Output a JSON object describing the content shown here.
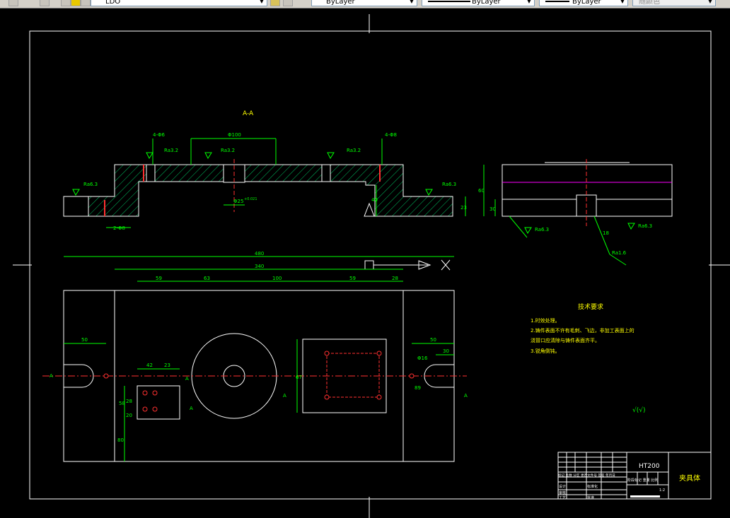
{
  "toolbar": {
    "layer_name": "LDO",
    "color_value": "ByLayer",
    "linetype_value": "ByLayer",
    "lineweight_value": "ByLayer",
    "plotstyle_value": "随颜色"
  },
  "drawing": {
    "section_title": "A-A",
    "section_labels": {
      "hole_4_left": "4-Φ6",
      "hole_4_right": "4-Φ8",
      "slot_2": "2-Φ8",
      "bore_100": "Φ100",
      "bore_25": "Φ25",
      "tol_h8": "H8",
      "tol_top": "+0.021",
      "tol_bot": "0",
      "dim_40": "40",
      "dim_23": "23",
      "dim_60": "60",
      "dim_30": "30",
      "dim_18": "18",
      "ra32_a": "Ra3.2",
      "ra32_b": "Ra3.2",
      "ra32_c": "Ra3.2",
      "ra32_d": "Ra3.2",
      "ra63_a": "Ra6.3",
      "ra63_b": "Ra6.3",
      "ra63_c": "Ra6.3",
      "ra63_d": "Ra6.3",
      "ra63_e": "Ra6.3",
      "ra16": "Ra1.6"
    },
    "plan_dims": {
      "overall_480": "480",
      "overall_340": "340",
      "d59_left": "59",
      "d63": "63",
      "d100": "100",
      "d59_right": "59",
      "d28": "28",
      "d50_left": "50",
      "d50_right": "50",
      "d30": "30",
      "d42": "42",
      "d23": "23",
      "d16": "Φ16",
      "d89": "89",
      "d67": "67",
      "d58": "58",
      "d28v": "28",
      "d20": "20",
      "d80": "80"
    },
    "section_marks": {
      "a_left": "A",
      "a_right": "A",
      "a_small1": "A",
      "a_small2": "A",
      "a_small3": "A"
    },
    "tech_req": {
      "title": "技术要求",
      "line1": "1.时效处理。",
      "line2": "2.铸件表面不许有毛刺、飞边，非加工表面上的",
      "line3": "   浇冒口应清除与铸件表面齐平。",
      "line4": "3.锐角倒钝。"
    },
    "roughness_note": "√(√)",
    "title_block": {
      "material": "HT200",
      "part_name": "夹具体",
      "row_labels": "标记 处数 分区 更改文件号 签名 年月日",
      "stage_labels": "阶段标记 重量 比例",
      "scale": "1:2",
      "designer": "设计",
      "checker": "审核",
      "process": "工艺",
      "standard": "标准化",
      "approve": "批准"
    }
  }
}
